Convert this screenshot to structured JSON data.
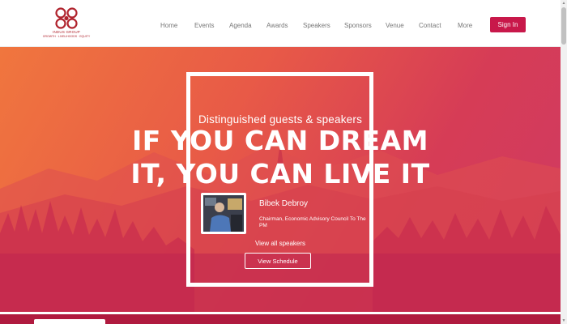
{
  "header": {
    "logo": {
      "name": "INDUS GROUP",
      "tagline": "GROWTH · LIVELIHOODS · EQUITY",
      "icon": "swirl-logo-icon",
      "color": "#b0232d"
    },
    "nav": [
      {
        "label": "Home"
      },
      {
        "label": "Events"
      },
      {
        "label": "Agenda"
      },
      {
        "label": "Awards"
      },
      {
        "label": "Speakers"
      },
      {
        "label": "Sponsors"
      },
      {
        "label": "Venue"
      },
      {
        "label": "Contact"
      },
      {
        "label": "More"
      }
    ],
    "signin_label": "Sign In",
    "signin_color": "#c8184a"
  },
  "hero": {
    "subtitle": "Distinguished guests & speakers",
    "headline_line1": "IF YOU CAN DREAM",
    "headline_line2": "IT, YOU CAN LIVE IT",
    "gradient": [
      "#f0763e",
      "#e85a47",
      "#d63c56",
      "#cf3a63"
    ],
    "speaker": {
      "name": "Bibek Debroy",
      "role": "Chairman, Economic Advisory Council To The PM"
    },
    "view_all_label": "View all speakers",
    "view_schedule_label": "View Schedule"
  },
  "footer_strip": {
    "color": "#b01a3f"
  }
}
